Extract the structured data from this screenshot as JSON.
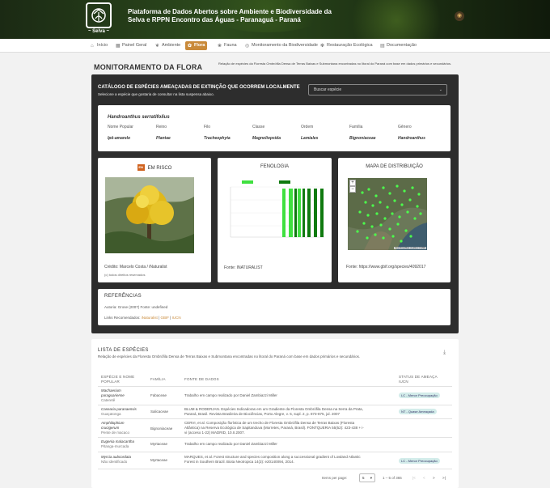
{
  "header": {
    "logo_text": "~ Selva ~",
    "title_line1": "Plataforma de Dados Abertos sobre Ambiente e Biodiversidade da",
    "title_line2": "Selva e RPPN Encontro das Águas - Paranaguá - Paraná"
  },
  "nav": {
    "items": [
      {
        "label": "Início",
        "icon": "home-icon"
      },
      {
        "label": "Painel Geral",
        "icon": "dashboard-icon"
      },
      {
        "label": "Ambiente",
        "icon": "leaf-icon"
      },
      {
        "label": "Flora",
        "icon": "flower-icon"
      },
      {
        "label": "Fauna",
        "icon": "paw-icon"
      },
      {
        "label": "Monitoramento da Biodiversidade",
        "icon": "binoculars-icon"
      },
      {
        "label": "Restauração Ecológica",
        "icon": "sprout-icon"
      },
      {
        "label": "Documentação",
        "icon": "document-icon"
      }
    ],
    "active": "Flora"
  },
  "page": {
    "title": "MONITORAMENTO DA FLORA",
    "subtitle": "Relação de espécies da Floresta Ombrófila Densa de Terras Baixas e Submontana encontradas no litoral do Paraná com base em dados primários e secundários."
  },
  "catalog": {
    "title": "CATÁLOGO DE ESPÉCIES AMEAÇADAS DE EXTINÇÃO QUE OCORREM LOCALMENTE",
    "subtitle": "Selecione a espécie que gostaria de consultar na lista suspensa abaixo.",
    "search_placeholder": "Buscar espécie"
  },
  "taxonomy": {
    "species": "Handroanthus serratifolius",
    "headers": [
      "Nome Popular",
      "Reino",
      "Filo",
      "Classe",
      "Ordem",
      "Família",
      "Gênero"
    ],
    "values": [
      "Ipê-amarelo",
      "Plantae",
      "Tracheophyta",
      "Magnoliopsida",
      "Lamiales",
      "Bignoniaceae",
      "Handroanthus"
    ]
  },
  "risk": {
    "badge": "EN",
    "title": "EM RISCO",
    "credit": "Crédito: Marcelo Costa / iNaturalist",
    "rights": "(c) todos direitos reservados"
  },
  "phenology": {
    "title": "FENOLOGIA",
    "source": "Fonte: INATURALIST"
  },
  "map": {
    "title": "MAPA DE DISTRIBUIÇÃO",
    "zoom_in": "+",
    "zoom_out": "−",
    "attribution": "OpenStreetMap | Leaflet | © ESRI",
    "source": "Fonte: https://www.gbif.org/species/4092017"
  },
  "references": {
    "title": "REFERÊNCIAS",
    "author": "Autoria: Grose (2007) Fonte: undefined",
    "links_label": "Links Recomendados:",
    "links": [
      "iNaturalist",
      "GBIF",
      "IUCN"
    ],
    "separator": " | "
  },
  "species_list": {
    "title": "LISTA DE ESPÉCIES",
    "subtitle": "Relação de espécies da Floresta Ombrófila Densa de Terras Baixas e Submontana encontradas no litoral do Paraná com base em dados primários e secundários.",
    "headers": {
      "species_l1": "ESPÉCIE E NOME",
      "species_l2": "POPULAR",
      "family": "FAMÍLIA",
      "source": "FONTE DE DADOS",
      "status_l1": "STATUS DE AMEAÇA",
      "status_l2": "IUCN"
    },
    "rows": [
      {
        "species_l1": "Machaerium",
        "species_l2": "paraguariense",
        "popular": "Cateretê",
        "family": "Fabaceae",
        "source_l1": "Trabalho em campo realizado por Daniel Zambiazzi Miller",
        "source_l2": "",
        "source_l3": "",
        "status": "LC - Menor Preocupação"
      },
      {
        "species_l1": "Casearia paranaensis",
        "species_l2": "",
        "popular": "Guaçatonga",
        "family": "Salicaceae",
        "source_l1": "BLUM & RODERJAN. Espécies Indicadoras em um Gradiente da Floresta Ombrófila Densa na Serra da Prata,",
        "source_l2": "Paraná, Brasil. Revista Brasileira de Biociências, Porto Alegre, v. 5, supl. 2, p. 873-875, jul. 2007",
        "source_l3": "",
        "status": "NT - Quase Ameaçada"
      },
      {
        "species_l1": "Amphilophium",
        "species_l2": "crucigerum",
        "popular": "Pente de macaco",
        "family": "Bignoniaceae",
        "source_l1": "CERVI, et al. Composição florística de um trecho de Floresta Ombrófila Densa de Terras Baixas (Floresta",
        "source_l2": "Atlântica) na Reserva Ecológica de Sapitanduva (Morretes, Paraná, Brasil). FONTQUERIA 55(52): 423-438 + i-",
        "source_l3": "vi (acceso 1-22) MADRID, 10.II.2007.",
        "status": ""
      },
      {
        "species_l1": "Eugenia malacantha",
        "species_l2": "",
        "popular": "Pitanga-murcada",
        "family": "Myrtaceae",
        "source_l1": "Trabalho em campo realizado por Daniel Zambiazzi Miller",
        "source_l2": "",
        "source_l3": "",
        "status": ""
      },
      {
        "species_l1": "Myrcia aubcordata",
        "species_l2": "",
        "popular": "Não identificado",
        "family": "Myrtaceae",
        "source_l1": "MARQUES, et al. Forest structure and species composition along a successional gradient of Lowland Atlantic",
        "source_l2": "Forest in Southern Brazil. Biota Neotropica 14(3): e20140094, 2014.",
        "source_l3": "",
        "status": "LC - Menor Preocupação"
      }
    ],
    "pagination": {
      "items_label": "Items per page:",
      "per_page": "5",
      "range": "1 – 5 of 365"
    }
  }
}
